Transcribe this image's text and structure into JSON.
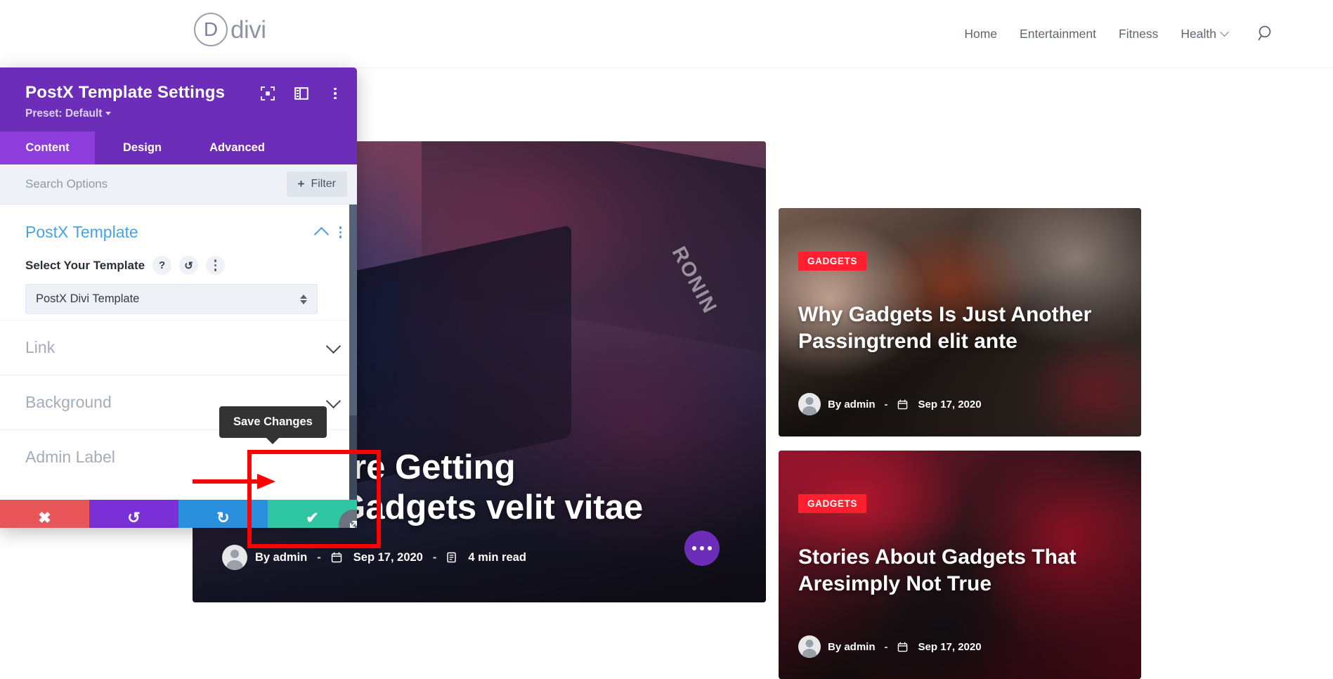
{
  "site": {
    "logo_letter": "D",
    "logo_word": "divi",
    "nav": [
      {
        "label": "Home",
        "has_caret": false
      },
      {
        "label": "Entertainment",
        "has_caret": false
      },
      {
        "label": "Fitness",
        "has_caret": false
      },
      {
        "label": "Health",
        "has_caret": true
      }
    ],
    "search_icon": "search-icon"
  },
  "hero": {
    "title_line1": "enials Are Getting",
    "title_line2": "Richer Gadgets velit vitae",
    "author": "By admin",
    "dash": "-",
    "date": "Sep 17, 2020",
    "read_time": "4 min read",
    "watermark": "RONIN"
  },
  "cards": [
    {
      "badge": "GADGETS",
      "title_line1": "Why Gadgets Is Just Another",
      "title_line2": "Passingtrend elit ante",
      "author": "By admin",
      "dash": "-",
      "date": "Sep 17, 2020"
    },
    {
      "badge": "GADGETS",
      "title_line1": "Stories About Gadgets That",
      "title_line2": "Aresimply Not True",
      "author": "By admin",
      "dash": "-",
      "date": "Sep 17, 2020"
    }
  ],
  "modal": {
    "title": "PostX Template Settings",
    "preset": "Preset: Default",
    "head_icons": [
      "focus-target-icon",
      "layout-panel-icon",
      "kebab-menu-icon"
    ],
    "tabs": [
      {
        "label": "Content",
        "active": true
      },
      {
        "label": "Design",
        "active": false
      },
      {
        "label": "Advanced",
        "active": false
      }
    ],
    "search_placeholder": "Search Options",
    "filter_plus": "+",
    "filter_label": "Filter",
    "section": {
      "title": "PostX Template",
      "field_label": "Select Your Template",
      "help_icon": "?",
      "reset_icon": "↺",
      "select_value": "PostX Divi Template"
    },
    "accordions": [
      {
        "label": "Link"
      },
      {
        "label": "Background"
      },
      {
        "label": "Admin Label"
      }
    ],
    "actions": [
      {
        "name": "cancel",
        "icon": "✖",
        "color": "#e8565a"
      },
      {
        "name": "undo",
        "icon": "↺",
        "color": "#7b2fd6"
      },
      {
        "name": "redo",
        "icon": "↻",
        "color": "#2a8fdd"
      },
      {
        "name": "save",
        "icon": "✔",
        "color": "#2fc6a3"
      }
    ],
    "tooltip": "Save Changes"
  },
  "colors": {
    "modal_header": "#6c2eb9",
    "tab_active": "#8c3ddb",
    "section_title": "#49a3e3",
    "badge_red": "#ff1f2e",
    "annotation_red": "#ff0000",
    "save_teal": "#2fc6a3"
  }
}
